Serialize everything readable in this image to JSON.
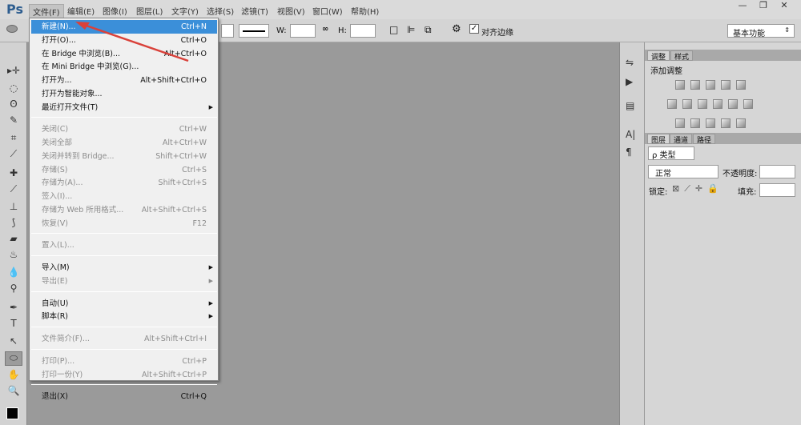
{
  "app": {
    "logo": "Ps"
  },
  "menubar": {
    "items": [
      "文件(F)",
      "编辑(E)",
      "图像(I)",
      "图层(L)",
      "文字(Y)",
      "选择(S)",
      "滤镜(T)",
      "视图(V)",
      "窗口(W)",
      "帮助(H)"
    ],
    "active": 0
  },
  "window_controls": {
    "minimize": "—",
    "restore": "❐",
    "close": "✕"
  },
  "options": {
    "w_label": "W:",
    "h_label": "H:",
    "w_value": "",
    "h_value": "",
    "align_edges_label": "对齐边缘",
    "align_edges_checked": true,
    "workspace": "基本功能"
  },
  "file_menu": {
    "items": [
      {
        "label": "新建(N)...",
        "shortcut": "Ctrl+N",
        "state": "highlighted"
      },
      {
        "label": "打开(O)...",
        "shortcut": "Ctrl+O"
      },
      {
        "label": "在 Bridge 中浏览(B)...",
        "shortcut": "Alt+Ctrl+O"
      },
      {
        "label": "在 Mini Bridge 中浏览(G)...",
        "shortcut": ""
      },
      {
        "label": "打开为...",
        "shortcut": "Alt+Shift+Ctrl+O"
      },
      {
        "label": "打开为智能对象...",
        "shortcut": ""
      },
      {
        "label": "最近打开文件(T)",
        "shortcut": "",
        "submenu": true
      },
      {
        "separator": true
      },
      {
        "label": "关闭(C)",
        "shortcut": "Ctrl+W",
        "disabled": true
      },
      {
        "label": "关闭全部",
        "shortcut": "Alt+Ctrl+W",
        "disabled": true
      },
      {
        "label": "关闭并转到 Bridge...",
        "shortcut": "Shift+Ctrl+W",
        "disabled": true
      },
      {
        "label": "存储(S)",
        "shortcut": "Ctrl+S",
        "disabled": true
      },
      {
        "label": "存储为(A)...",
        "shortcut": "Shift+Ctrl+S",
        "disabled": true
      },
      {
        "label": "签入(I)...",
        "shortcut": "",
        "disabled": true
      },
      {
        "label": "存储为 Web 所用格式...",
        "shortcut": "Alt+Shift+Ctrl+S",
        "disabled": true
      },
      {
        "label": "恢复(V)",
        "shortcut": "F12",
        "disabled": true
      },
      {
        "separator": true
      },
      {
        "label": "置入(L)...",
        "shortcut": "",
        "disabled": true
      },
      {
        "separator": true
      },
      {
        "label": "导入(M)",
        "shortcut": "",
        "submenu": true
      },
      {
        "label": "导出(E)",
        "shortcut": "",
        "submenu": true,
        "disabled": true
      },
      {
        "separator": true
      },
      {
        "label": "自动(U)",
        "shortcut": "",
        "submenu": true
      },
      {
        "label": "脚本(R)",
        "shortcut": "",
        "submenu": true
      },
      {
        "separator": true
      },
      {
        "label": "文件简介(F)...",
        "shortcut": "Alt+Shift+Ctrl+I",
        "disabled": true
      },
      {
        "separator": true
      },
      {
        "label": "打印(P)...",
        "shortcut": "Ctrl+P",
        "disabled": true
      },
      {
        "label": "打印一份(Y)",
        "shortcut": "Alt+Shift+Ctrl+P",
        "disabled": true
      },
      {
        "separator": true
      },
      {
        "label": "退出(X)",
        "shortcut": "Ctrl+Q"
      }
    ]
  },
  "tools": [
    "move",
    "marquee-ellipse",
    "lasso",
    "quick-select",
    "crop",
    "eyedropper",
    "healing",
    "brush",
    "stamp",
    "history-brush",
    "eraser",
    "paint-bucket",
    "blur",
    "dodge",
    "pen",
    "type",
    "path-select",
    "ellipse-shape",
    "hand",
    "zoom"
  ],
  "tool_glyphs": [
    "▸✛",
    "◌",
    "ʘ",
    "✎",
    "⌗",
    "⟋",
    "✚",
    "⟋",
    "⊥",
    "⟆",
    "▰",
    "♨",
    "💧",
    "⚲",
    "✒",
    "T",
    "↖",
    "⬭",
    "✋",
    "🔍"
  ],
  "active_tool": "ellipse-shape",
  "adjustments_panel": {
    "tabs": [
      "调整",
      "样式"
    ],
    "title": "添加调整"
  },
  "layers_panel": {
    "tabs": [
      "图层",
      "通道",
      "路径"
    ],
    "filter": "ρ 类型",
    "blend_mode": "正常",
    "opacity_label": "不透明度:",
    "lock_label": "锁定:",
    "fill_label": "填充:"
  },
  "dock": {
    "glyphs": [
      "⇋",
      "▶",
      "▤",
      "A|",
      "¶"
    ]
  },
  "colors": {
    "highlight": "#3b8fd9",
    "annotation_arrow": "#d9413a"
  }
}
